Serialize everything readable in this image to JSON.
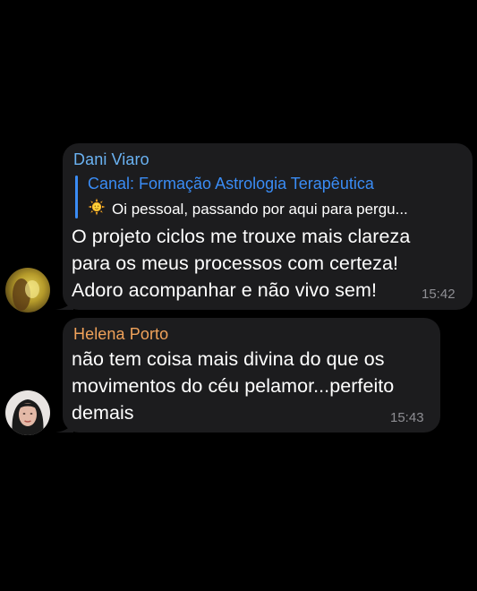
{
  "messages": [
    {
      "sender": "Dani Viaro",
      "sender_color": "#6ab2f2",
      "reply": {
        "title": "Canal: Formação Astrologia Terapêutica",
        "text": "Oi pessoal, passando por aqui para pergu...",
        "accent": "#3a8cf5",
        "icon": "sun-emoji-icon"
      },
      "lines": [
        "O projeto ciclos me trouxe mais clareza",
        "para os meus processos com certeza!",
        "Adoro acompanhar e não vivo sem!"
      ],
      "time": "15:42",
      "avatar": "avatar-dani"
    },
    {
      "sender": "Helena Porto",
      "sender_color": "#f0a25a",
      "lines": [
        "não tem coisa mais divina do que os",
        "movimentos do céu pelamor...perfeito",
        "demais"
      ],
      "time": "15:43",
      "avatar": "avatar-helena"
    }
  ]
}
